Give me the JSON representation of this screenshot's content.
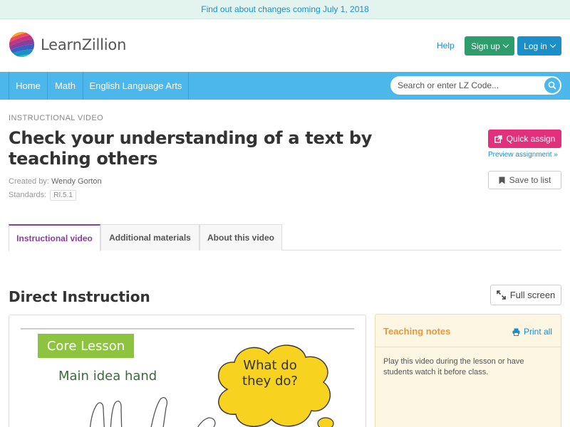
{
  "banner": {
    "text": "Find out about changes coming July 1, 2018"
  },
  "header": {
    "logo_text": "LearnZillion",
    "help": "Help",
    "signup": "Sign up",
    "login": "Log in"
  },
  "nav": {
    "items": [
      "Home",
      "Math",
      "English Language Arts"
    ],
    "search_placeholder": "Search or enter LZ Code..."
  },
  "lesson": {
    "eyebrow": "INSTRUCTIONAL VIDEO",
    "title": "Check your understanding of a text by teaching others",
    "created_label": "Created by:",
    "created_by": "Wendy Gorton",
    "standards_label": "Standards:",
    "standard": "RI.5.1"
  },
  "actions": {
    "quick_assign": "Quick assign",
    "preview": "Preview assignment »",
    "save": "Save to list"
  },
  "tabs": [
    "Instructional video",
    "Additional materials",
    "About this video"
  ],
  "section": {
    "title": "Direct Instruction",
    "fullscreen": "Full screen"
  },
  "video": {
    "core_lesson": "Core Lesson",
    "main_idea": "Main idea hand",
    "bubble_line1": "What do",
    "bubble_line2": "they do?"
  },
  "notes": {
    "title": "Teaching notes",
    "print": "Print all",
    "body": "Play this video during the lesson or have students watch it before class."
  },
  "colors": {
    "nav": "#4cb7ea",
    "signup": "#2e9d6d",
    "login": "#1a8fc9",
    "quick_assign": "#e2307d",
    "active_tab": "#8a3d9b",
    "notes_title": "#e39a3b"
  }
}
